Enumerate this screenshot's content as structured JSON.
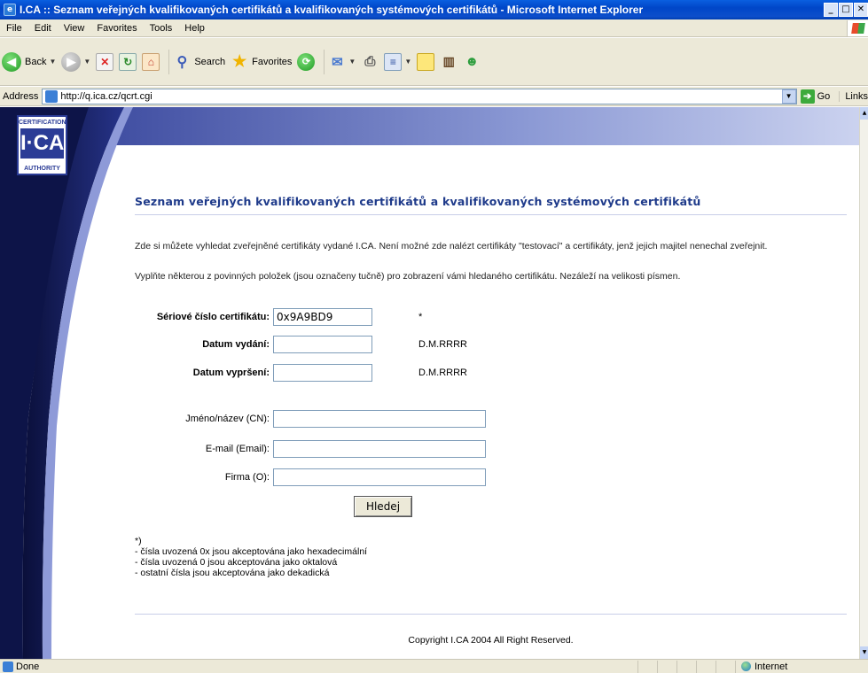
{
  "window": {
    "title": "I.CA :: Seznam veřejných kvalifikovaných certifikátů a kvalifikovaných systémových certifikátů - Microsoft Internet Explorer",
    "minimize": "_",
    "maximize": "□",
    "close": "✕"
  },
  "menu": [
    "File",
    "Edit",
    "View",
    "Favorites",
    "Tools",
    "Help"
  ],
  "toolbar": {
    "back": "Back",
    "search": "Search",
    "favorites": "Favorites"
  },
  "address": {
    "label": "Address",
    "url": "http://q.ica.cz/qcrt.cgi",
    "go": "Go",
    "links": "Links"
  },
  "logo": {
    "line1": "CERTIFICATION",
    "line2": "I·CA",
    "line3": "AUTHORITY"
  },
  "page": {
    "heading": "Seznam veřejných kvalifikovaných certifikátů a kvalifikovaných systémových certifikátů",
    "intro1": "Zde si můžete vyhledat zveřejněné certifikáty vydané I.CA. Není možné zde nalézt certifikáty \"testovací\" a certifikáty, jenž jejich majitel nenechal zveřejnit.",
    "intro2": "Vyplňte některou z povinných položek (jsou označeny tučně) pro zobrazení vámi hledaného certifikátu. Nezáleží na velikosti písmen."
  },
  "form": {
    "serial": {
      "label": "Sériové číslo certifikátu:",
      "value": "0x9A9BD9",
      "hint": "*"
    },
    "issued": {
      "label": "Datum vydání:",
      "value": "",
      "hint": "D.M.RRRR"
    },
    "expiry": {
      "label": "Datum vypršení:",
      "value": "",
      "hint": "D.M.RRRR"
    },
    "cn": {
      "label": "Jméno/název (CN):",
      "value": ""
    },
    "email": {
      "label": "E-mail (Email):",
      "value": ""
    },
    "org": {
      "label": "Firma (O):",
      "value": ""
    },
    "submit": "Hledej"
  },
  "notes": {
    "mark": "*)",
    "lines": [
      "- čísla uvozená 0x jsou akceptována jako hexadecimální",
      "- čísla uvozená 0 jsou akceptována jako oktalová",
      "- ostatní čísla jsou akceptována jako dekadická"
    ]
  },
  "footer": "Copyright I.CA 2004 All Right Reserved.",
  "status": {
    "left": "Done",
    "zone": "Internet"
  }
}
